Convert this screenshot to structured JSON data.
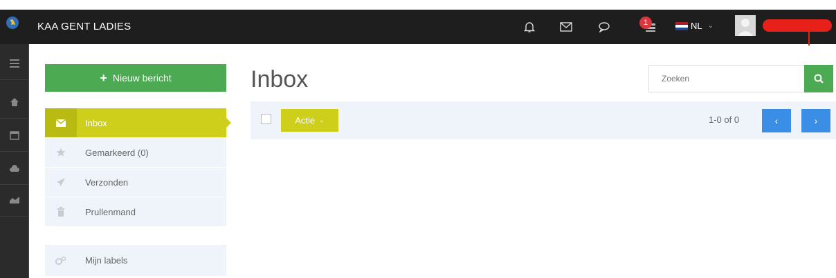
{
  "header": {
    "brand": "KAA GENT LADIES",
    "notification_count": "1",
    "language": "NL"
  },
  "sidebar": {
    "new_message": "Nieuw bericht",
    "items": [
      {
        "label": "Inbox",
        "icon": "envelope-icon"
      },
      {
        "label": "Gemarkeerd (0)",
        "icon": "star-icon"
      },
      {
        "label": "Verzonden",
        "icon": "paper-plane-icon"
      },
      {
        "label": "Prullenmand",
        "icon": "trash-icon"
      }
    ],
    "labels_item": "Mijn labels"
  },
  "main": {
    "title": "Inbox",
    "search_placeholder": "Zoeken",
    "action_label": "Actie",
    "pagination": "1-0 of 0"
  },
  "colors": {
    "topbar": "#1e1e1e",
    "accent_yellow": "#cdcf1a",
    "green": "#4caa53",
    "blue": "#3a8ee6"
  }
}
